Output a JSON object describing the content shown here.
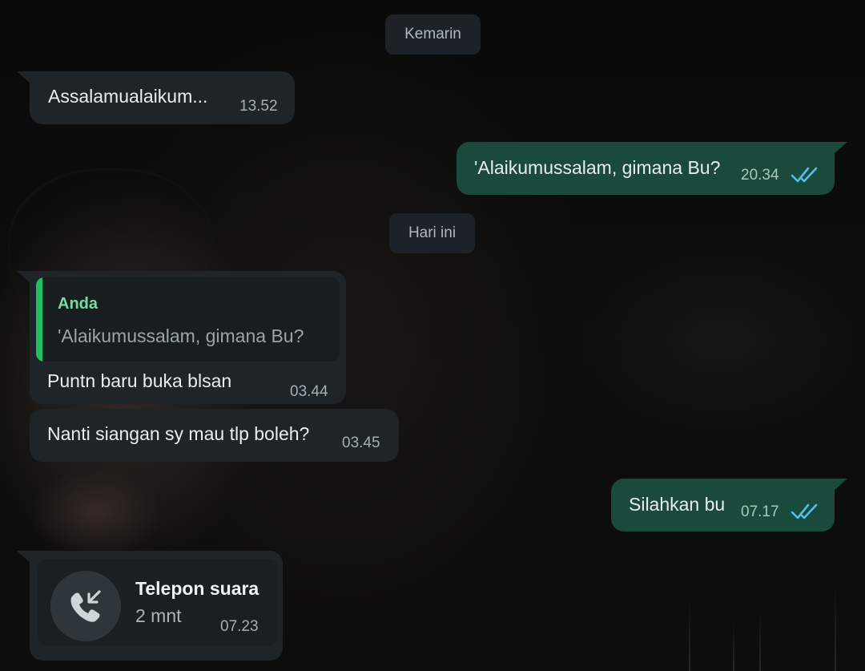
{
  "chat": {
    "dates": {
      "yesterday": "Kemarin",
      "today": "Hari ini"
    },
    "messages": [
      {
        "direction": "in",
        "text": "Assalamualaikum...",
        "time": "13.52"
      },
      {
        "direction": "out",
        "text": "'Alaikumussalam, gimana Bu?",
        "time": "20.34",
        "status": "read"
      },
      {
        "direction": "in",
        "quote": {
          "author": "Anda",
          "text": "'Alaikumussalam, gimana Bu?"
        },
        "text": "Puntn baru buka blsan",
        "time": "03.44"
      },
      {
        "direction": "in",
        "text": "Nanti siangan sy mau tlp boleh?",
        "time": "03.45"
      },
      {
        "direction": "out",
        "text": "Silahkan bu",
        "time": "07.17",
        "status": "read"
      },
      {
        "direction": "in",
        "call": {
          "title": "Telepon suara",
          "duration": "2 mnt",
          "icon": "incoming-call-icon"
        },
        "time": "07.23"
      }
    ]
  },
  "colors": {
    "incoming_bubble": "#1e2428",
    "outgoing_bubble": "#1a4a3b",
    "read_ticks": "#53bdeb",
    "quote_bar": "#21c063",
    "quote_author": "#7ad9a3"
  }
}
